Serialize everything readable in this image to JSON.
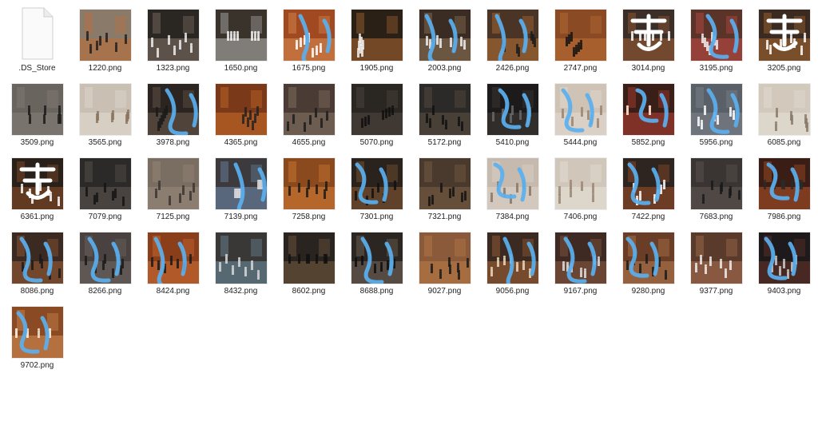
{
  "window": {
    "view": "icon-grid"
  },
  "files": [
    {
      "name": ".DS_Store",
      "kind": "document",
      "thumb": {
        "bg": "#ffffff"
      }
    },
    {
      "name": "1220.png",
      "kind": "image",
      "thumb": {
        "bg": "#8a7a6a",
        "accent": "#c96a2a",
        "figure": "#202020",
        "overlay": "none"
      }
    },
    {
      "name": "1323.png",
      "kind": "image",
      "thumb": {
        "bg": "#2a2622",
        "accent": "#9a8a7a",
        "figure": "#eeeeee",
        "overlay": "none"
      }
    },
    {
      "name": "1650.png",
      "kind": "image",
      "thumb": {
        "bg": "#3a332c",
        "accent": "#d8d8d8",
        "figure": "#f4f4f4",
        "overlay": "none"
      }
    },
    {
      "name": "1675.png",
      "kind": "image",
      "thumb": {
        "bg": "#a14a22",
        "accent": "#e8a060",
        "figure": "#ffffff",
        "overlay": "blue-script"
      }
    },
    {
      "name": "1905.png",
      "kind": "image",
      "thumb": {
        "bg": "#2a2016",
        "accent": "#c97a3a",
        "figure": "#f0f0f0",
        "overlay": "none"
      }
    },
    {
      "name": "2003.png",
      "kind": "image",
      "thumb": {
        "bg": "#3a2c22",
        "accent": "#a88a6a",
        "figure": "#eeeeee",
        "overlay": "blue-script"
      }
    },
    {
      "name": "2426.png",
      "kind": "image",
      "thumb": {
        "bg": "#4a3426",
        "accent": "#d0803a",
        "figure": "#1c1c1c",
        "overlay": "blue-script"
      }
    },
    {
      "name": "2747.png",
      "kind": "image",
      "thumb": {
        "bg": "#8a4a24",
        "accent": "#c77a3a",
        "figure": "#141414",
        "overlay": "none"
      }
    },
    {
      "name": "3014.png",
      "kind": "image",
      "thumb": {
        "bg": "#3a2e26",
        "accent": "#b86a3a",
        "figure": "#ffffff",
        "overlay": "white-glyph"
      }
    },
    {
      "name": "3195.png",
      "kind": "image",
      "thumb": {
        "bg": "#5a3428",
        "accent": "#e05050",
        "figure": "#f0f0f0",
        "overlay": "blue-script"
      }
    },
    {
      "name": "3205.png",
      "kind": "image",
      "thumb": {
        "bg": "#3a2a20",
        "accent": "#c87a3a",
        "figure": "#ffffff",
        "overlay": "white-glyph"
      }
    },
    {
      "name": "3509.png",
      "kind": "image",
      "thumb": {
        "bg": "#6a645e",
        "accent": "#8a8480",
        "figure": "#1a1a1a",
        "overlay": "none"
      }
    },
    {
      "name": "3565.png",
      "kind": "image",
      "thumb": {
        "bg": "#c9bfb3",
        "accent": "#e8e2d9",
        "figure": "#8a7460",
        "overlay": "none"
      }
    },
    {
      "name": "3978.png",
      "kind": "image",
      "thumb": {
        "bg": "#2c2420",
        "accent": "#7a6a5a",
        "figure": "#1a1a1a",
        "overlay": "blue-script"
      }
    },
    {
      "name": "4365.png",
      "kind": "image",
      "thumb": {
        "bg": "#7a3a1a",
        "accent": "#e07a2a",
        "figure": "#222222",
        "overlay": "none"
      }
    },
    {
      "name": "4655.png",
      "kind": "image",
      "thumb": {
        "bg": "#4a3c34",
        "accent": "#9a8474",
        "figure": "#1c1c1c",
        "overlay": "none"
      }
    },
    {
      "name": "5070.png",
      "kind": "image",
      "thumb": {
        "bg": "#2a2622",
        "accent": "#5a524a",
        "figure": "#101010",
        "overlay": "none"
      }
    },
    {
      "name": "5172.png",
      "kind": "image",
      "thumb": {
        "bg": "#2c2a28",
        "accent": "#6a5a4a",
        "figure": "#121212",
        "overlay": "none"
      }
    },
    {
      "name": "5410.png",
      "kind": "image",
      "thumb": {
        "bg": "#1c1a1a",
        "accent": "#4a4440",
        "figure": "#6a6a6a",
        "overlay": "blue-script"
      }
    },
    {
      "name": "5444.png",
      "kind": "image",
      "thumb": {
        "bg": "#cfc3b6",
        "accent": "#e9e1d6",
        "figure": "#9a8470",
        "overlay": "blue-script"
      }
    },
    {
      "name": "5852.png",
      "kind": "image",
      "thumb": {
        "bg": "#3a1e18",
        "accent": "#d84a3a",
        "figure": "#f4d0c0",
        "overlay": "blue-script"
      }
    },
    {
      "name": "5956.png",
      "kind": "image",
      "thumb": {
        "bg": "#5a6068",
        "accent": "#8a8e94",
        "figure": "#ffffff",
        "overlay": "blue-script"
      }
    },
    {
      "name": "6085.png",
      "kind": "image",
      "thumb": {
        "bg": "#d2c8bc",
        "accent": "#ece6dc",
        "figure": "#8a7a6a",
        "overlay": "none"
      }
    },
    {
      "name": "6361.png",
      "kind": "image",
      "thumb": {
        "bg": "#2a201a",
        "accent": "#a45a2a",
        "figure": "#ffffff",
        "overlay": "white-glyph"
      }
    },
    {
      "name": "7079.png",
      "kind": "image",
      "thumb": {
        "bg": "#2c2a28",
        "accent": "#6a625a",
        "figure": "#141414",
        "overlay": "none"
      }
    },
    {
      "name": "7125.png",
      "kind": "image",
      "thumb": {
        "bg": "#7a6e62",
        "accent": "#a09282",
        "figure": "#3a3430",
        "overlay": "none"
      }
    },
    {
      "name": "7139.png",
      "kind": "image",
      "thumb": {
        "bg": "#3c3a3c",
        "accent": "#7aa0c8",
        "figure": "#dddddd",
        "overlay": "blue-script"
      }
    },
    {
      "name": "7258.png",
      "kind": "image",
      "thumb": {
        "bg": "#8a4a1e",
        "accent": "#e88a3a",
        "figure": "#1a1a1a",
        "overlay": "none"
      }
    },
    {
      "name": "7301.png",
      "kind": "image",
      "thumb": {
        "bg": "#2a221c",
        "accent": "#a06a3a",
        "figure": "#101010",
        "overlay": "blue-script"
      }
    },
    {
      "name": "7321.png",
      "kind": "image",
      "thumb": {
        "bg": "#4a3a2e",
        "accent": "#8a6a4a",
        "figure": "#141414",
        "overlay": "none"
      }
    },
    {
      "name": "7384.png",
      "kind": "image",
      "thumb": {
        "bg": "#c6baae",
        "accent": "#e2dad0",
        "figure": "#8a7462",
        "overlay": "blue-script"
      }
    },
    {
      "name": "7406.png",
      "kind": "image",
      "thumb": {
        "bg": "#d0c6ba",
        "accent": "#eee8de",
        "figure": "#9a8674",
        "overlay": "none"
      }
    },
    {
      "name": "7422.png",
      "kind": "image",
      "thumb": {
        "bg": "#2e2420",
        "accent": "#b85a2a",
        "figure": "#ffffff",
        "overlay": "blue-script"
      }
    },
    {
      "name": "7683.png",
      "kind": "image",
      "thumb": {
        "bg": "#3a3432",
        "accent": "#6a625e",
        "figure": "#1a1a1a",
        "overlay": "none"
      }
    },
    {
      "name": "7986.png",
      "kind": "image",
      "thumb": {
        "bg": "#3a1e16",
        "accent": "#d0602a",
        "figure": "#2a2a2a",
        "overlay": "blue-script"
      }
    },
    {
      "name": "8086.png",
      "kind": "image",
      "thumb": {
        "bg": "#3a2a22",
        "accent": "#b86a3a",
        "figure": "#1a1a1a",
        "overlay": "blue-script"
      }
    },
    {
      "name": "8266.png",
      "kind": "image",
      "thumb": {
        "bg": "#4a4240",
        "accent": "#7a706c",
        "figure": "#1a1a1a",
        "overlay": "blue-script"
      }
    },
    {
      "name": "8424.png",
      "kind": "image",
      "thumb": {
        "bg": "#8a3e1a",
        "accent": "#e07a3a",
        "figure": "#1a1a1a",
        "overlay": "blue-script"
      }
    },
    {
      "name": "8432.png",
      "kind": "image",
      "thumb": {
        "bg": "#3a3836",
        "accent": "#7aa4bc",
        "figure": "#d8d8d8",
        "overlay": "none"
      }
    },
    {
      "name": "8602.png",
      "kind": "image",
      "thumb": {
        "bg": "#2a2420",
        "accent": "#8a6a4a",
        "figure": "#101010",
        "overlay": "none"
      }
    },
    {
      "name": "8688.png",
      "kind": "image",
      "thumb": {
        "bg": "#2c2622",
        "accent": "#8a7a6a",
        "figure": "#0e0e0e",
        "overlay": "blue-script"
      }
    },
    {
      "name": "9027.png",
      "kind": "image",
      "thumb": {
        "bg": "#8a5a3a",
        "accent": "#c8844a",
        "figure": "#1a1a1a",
        "overlay": "none"
      }
    },
    {
      "name": "9056.png",
      "kind": "image",
      "thumb": {
        "bg": "#3a2a22",
        "accent": "#c0703a",
        "figure": "#f0d8b8",
        "overlay": "blue-script"
      }
    },
    {
      "name": "9167.png",
      "kind": "image",
      "thumb": {
        "bg": "#3e2a22",
        "accent": "#a0664a",
        "figure": "#e0e0e0",
        "overlay": "blue-script"
      }
    },
    {
      "name": "9280.png",
      "kind": "image",
      "thumb": {
        "bg": "#6a3e26",
        "accent": "#c88a5a",
        "figure": "#1a1a1a",
        "overlay": "blue-script"
      }
    },
    {
      "name": "9377.png",
      "kind": "image",
      "thumb": {
        "bg": "#5a3a2a",
        "accent": "#c0805a",
        "figure": "#eeeeee",
        "overlay": "none"
      }
    },
    {
      "name": "9403.png",
      "kind": "image",
      "thumb": {
        "bg": "#1e1a1c",
        "accent": "#7a3a2a",
        "figure": "#cccccc",
        "overlay": "blue-script"
      }
    },
    {
      "name": "9702.png",
      "kind": "image",
      "thumb": {
        "bg": "#8a4a24",
        "accent": "#e6a060",
        "figure": "#f4e4d0",
        "overlay": "blue-script"
      }
    }
  ]
}
